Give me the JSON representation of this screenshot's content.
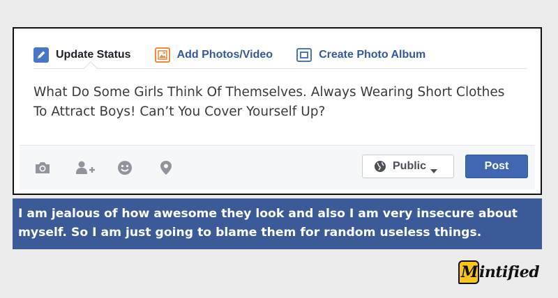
{
  "composer": {
    "tabs": [
      {
        "label": "Update Status",
        "icon": "pencil-icon",
        "active": true
      },
      {
        "label": "Add Photos/Video",
        "icon": "photo-icon",
        "active": false
      },
      {
        "label": "Create Photo Album",
        "icon": "album-icon",
        "active": false
      }
    ],
    "status_text": "What Do Some Girls Think Of Themselves. Always Wearing Short Clothes To Attract Boys! Can’t You Cover Yourself Up?",
    "footer_icons": [
      "camera-icon",
      "tag-friends-icon",
      "feeling-icon",
      "location-icon"
    ],
    "privacy_label": "Public",
    "post_label": "Post"
  },
  "caption": "I am jealous of how awesome they look and also I am very insecure about myself. So I am just going to blame them for random useless things.",
  "logo": {
    "badge_letter": "M",
    "text": "intified"
  },
  "colors": {
    "page_bg": "#ebebeb",
    "link_blue": "#365899",
    "post_blue": "#4267b2",
    "caption_bg": "#3d5a98",
    "logo_yellow": "#f7c51d"
  }
}
